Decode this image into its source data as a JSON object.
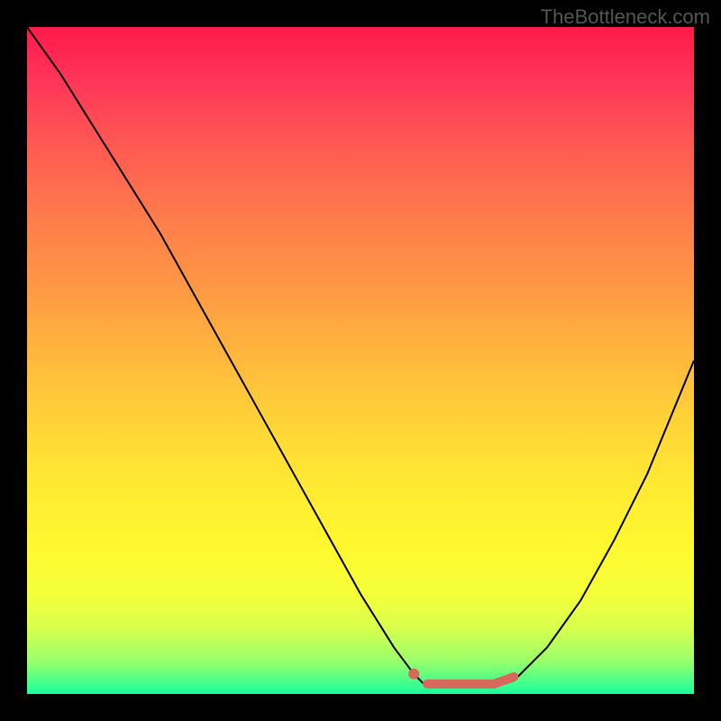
{
  "watermark": "TheBottleneck.com",
  "chart_data": {
    "type": "line",
    "title": "",
    "xlabel": "",
    "ylabel": "",
    "xlim": [
      0,
      100
    ],
    "ylim": [
      0,
      100
    ],
    "gradient_background": {
      "top_color": "#ff1a4a",
      "bottom_color": "#1aff9e",
      "description": "vertical gradient red-yellow-green (bottleneck severity)"
    },
    "series": [
      {
        "name": "bottleneck-curve",
        "color": "#000000",
        "x": [
          0,
          5,
          10,
          15,
          20,
          25,
          30,
          35,
          40,
          45,
          50,
          55,
          58,
          60,
          65,
          70,
          73,
          78,
          83,
          88,
          93,
          100
        ],
        "values": [
          100,
          93,
          85,
          77,
          69,
          60,
          51,
          42,
          33,
          24,
          15,
          7,
          3,
          1,
          1,
          1,
          2,
          7,
          14,
          23,
          33,
          50
        ]
      }
    ],
    "annotations": {
      "optimal_dot": {
        "x": 58,
        "y": 3
      },
      "optimal_range_highlight": {
        "x_start": 60,
        "x_end": 73,
        "y": 1.5,
        "color": "#d9675b"
      }
    }
  }
}
